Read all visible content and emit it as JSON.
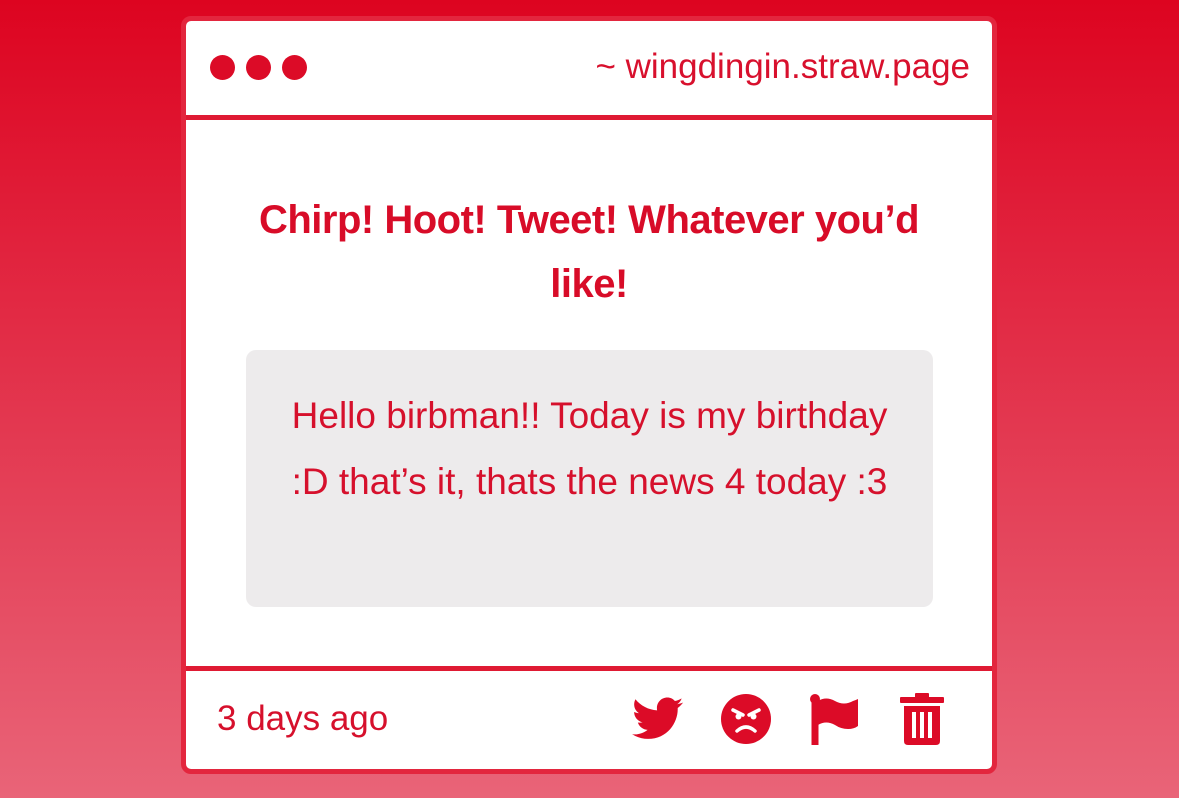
{
  "window": {
    "url": "~ wingdingin.straw.page"
  },
  "post": {
    "headline": "Chirp! Hoot! Tweet! Whatever you’d like!",
    "message": "Hello birbman!! Today is my birthday :D that’s it, thats the news 4 today :3",
    "timestamp": "3 days ago"
  },
  "actions": [
    {
      "icon": "bird-icon",
      "label": "chirp"
    },
    {
      "icon": "angry-face-icon",
      "label": "angry reaction"
    },
    {
      "icon": "flag-icon",
      "label": "report"
    },
    {
      "icon": "trash-icon",
      "label": "delete"
    }
  ],
  "colors": {
    "accent": "#dc0b27",
    "border": "#e3263e",
    "message_bg": "#edebec",
    "background_top": "#dd0420",
    "background_bottom": "#e96478"
  }
}
